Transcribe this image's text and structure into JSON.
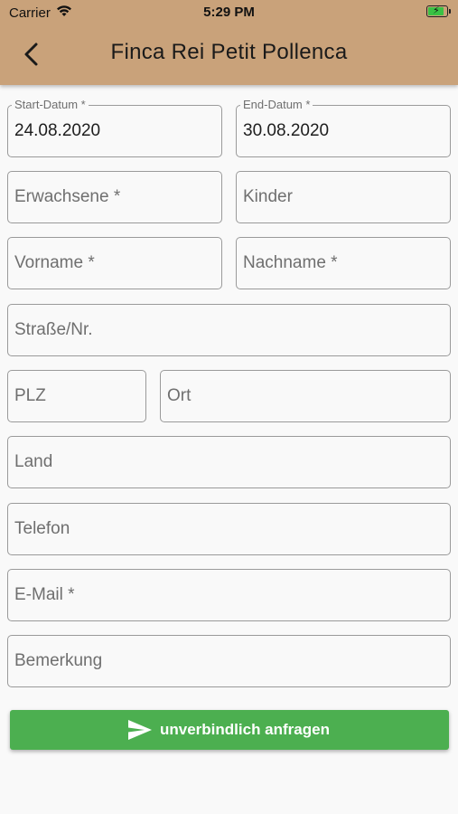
{
  "status_bar": {
    "carrier": "Carrier",
    "time": "5:29 PM",
    "wifi_icon": "wifi-icon",
    "battery_icon": "battery-charging-icon"
  },
  "header": {
    "title": "Finca Rei Petit Pollenca",
    "back_icon": "chevron-left-icon",
    "color": "#c9a27a"
  },
  "form": {
    "start_date": {
      "label": "Start-Datum *",
      "value": "24.08.2020"
    },
    "end_date": {
      "label": "End-Datum *",
      "value": "30.08.2020"
    },
    "adults": {
      "placeholder": "Erwachsene *"
    },
    "children": {
      "placeholder": "Kinder"
    },
    "first_name": {
      "placeholder": "Vorname *"
    },
    "last_name": {
      "placeholder": "Nachname *"
    },
    "street": {
      "placeholder": "Straße/Nr."
    },
    "zip": {
      "placeholder": "PLZ"
    },
    "city": {
      "placeholder": "Ort"
    },
    "country": {
      "placeholder": "Land"
    },
    "phone": {
      "placeholder": "Telefon"
    },
    "email": {
      "placeholder": "E-Mail *"
    },
    "remarks": {
      "placeholder": "Bemerkung"
    }
  },
  "submit": {
    "label": "unverbindlich anfragen",
    "icon": "send-icon",
    "color": "#4caf50"
  }
}
